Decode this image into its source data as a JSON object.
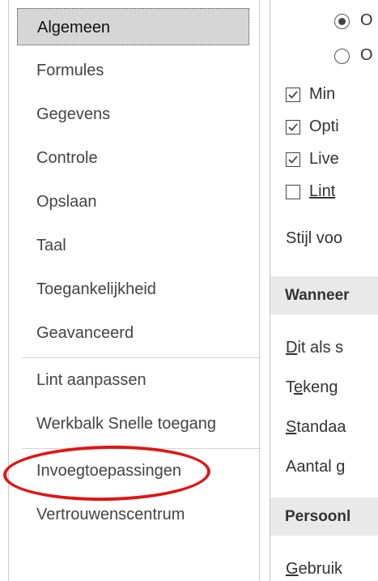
{
  "sidebar": {
    "items": [
      {
        "label": "Algemeen"
      },
      {
        "label": "Formules"
      },
      {
        "label": "Gegevens"
      },
      {
        "label": "Controle"
      },
      {
        "label": "Opslaan"
      },
      {
        "label": "Taal"
      },
      {
        "label": "Toegankelijkheid"
      },
      {
        "label": "Geavanceerd"
      },
      {
        "label": "Lint aanpassen"
      },
      {
        "label": "Werkbalk Snelle toegang"
      },
      {
        "label": "Invoegtoepassingen"
      },
      {
        "label": "Vertrouwenscentrum"
      }
    ],
    "selected": "Algemeen",
    "highlighted": "Invoegtoepassingen"
  },
  "content": {
    "radios": [
      {
        "label": "O",
        "checked": true
      },
      {
        "label": "O",
        "checked": false
      }
    ],
    "checkboxes": [
      {
        "label": "Min",
        "checked": true
      },
      {
        "label": "Opti",
        "checked": true
      },
      {
        "label": "Live",
        "checked": true
      },
      {
        "label": "Lint",
        "checked": false
      }
    ],
    "style_label": "Stijl voo",
    "section1_title": "Wanneer",
    "fields": [
      {
        "pre": "",
        "ul": "D",
        "post": "it als s"
      },
      {
        "pre": "T",
        "ul": "e",
        "post": "keng"
      },
      {
        "pre": "",
        "ul": "S",
        "post": "tandaa"
      },
      {
        "pre": "Aantal ",
        "ul": "g",
        "post": ""
      }
    ],
    "section2_title": "Persoonl",
    "bottom_field": {
      "pre": "",
      "ul": "G",
      "post": "ebruik"
    }
  },
  "colors": {
    "highlight_ellipse": "#e01515",
    "selected_bg": "#d6d6d6",
    "section_bg": "#e9e9e9"
  }
}
